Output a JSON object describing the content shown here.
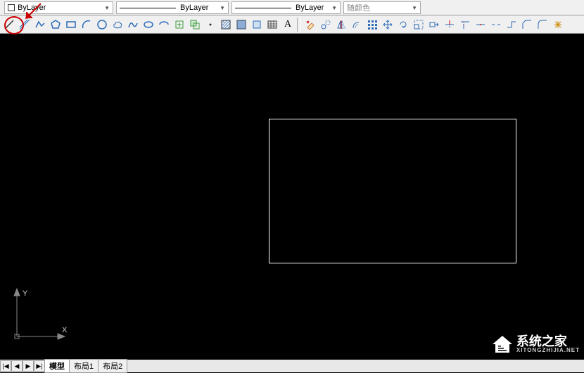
{
  "dropdowns": {
    "layer": {
      "label": "ByLayer"
    },
    "linetype": {
      "label": "ByLayer"
    },
    "lineweight": {
      "label": "ByLayer"
    },
    "color": {
      "label": "随颜色"
    }
  },
  "draw_tools": [
    {
      "name": "line-tool",
      "icon": "line"
    },
    {
      "name": "construction-line-tool",
      "icon": "xline"
    },
    {
      "name": "polyline-tool",
      "icon": "pline"
    },
    {
      "name": "polygon-tool",
      "icon": "polygon"
    },
    {
      "name": "rectangle-tool",
      "icon": "rect"
    },
    {
      "name": "arc-tool",
      "icon": "arc"
    },
    {
      "name": "circle-tool",
      "icon": "circle"
    },
    {
      "name": "revcloud-tool",
      "icon": "cloud"
    },
    {
      "name": "spline-tool",
      "icon": "spline"
    },
    {
      "name": "ellipse-tool",
      "icon": "ellipse"
    },
    {
      "name": "ellipse-arc-tool",
      "icon": "ellipsearc"
    },
    {
      "name": "insert-block-tool",
      "icon": "insert"
    },
    {
      "name": "make-block-tool",
      "icon": "block"
    },
    {
      "name": "point-tool",
      "icon": "point"
    },
    {
      "name": "hatch-tool",
      "icon": "hatch"
    },
    {
      "name": "gradient-tool",
      "icon": "gradient"
    },
    {
      "name": "region-tool",
      "icon": "region"
    },
    {
      "name": "table-tool",
      "icon": "table"
    },
    {
      "name": "text-tool",
      "icon": "text",
      "label": "A"
    }
  ],
  "modify_tools": [
    {
      "name": "erase-tool",
      "icon": "erase"
    },
    {
      "name": "copy-tool",
      "icon": "copy"
    },
    {
      "name": "mirror-tool",
      "icon": "mirror"
    },
    {
      "name": "offset-tool",
      "icon": "offset"
    },
    {
      "name": "array-tool",
      "icon": "array"
    },
    {
      "name": "move-tool",
      "icon": "move"
    },
    {
      "name": "rotate-tool",
      "icon": "rotate"
    },
    {
      "name": "scale-tool",
      "icon": "scale"
    },
    {
      "name": "stretch-tool",
      "icon": "stretch"
    },
    {
      "name": "trim-tool",
      "icon": "trim"
    },
    {
      "name": "extend-tool",
      "icon": "extend"
    },
    {
      "name": "break-at-point-tool",
      "icon": "breakpt"
    },
    {
      "name": "break-tool",
      "icon": "break"
    },
    {
      "name": "join-tool",
      "icon": "join"
    },
    {
      "name": "chamfer-tool",
      "icon": "chamfer"
    },
    {
      "name": "fillet-tool",
      "icon": "fillet"
    },
    {
      "name": "explode-tool",
      "icon": "explode"
    }
  ],
  "ucs": {
    "x_label": "X",
    "y_label": "Y"
  },
  "watermark": {
    "text": "系统之家",
    "sub": "XITONGZHIJIA.NET"
  },
  "tabs": {
    "nav": [
      "|◀",
      "◀",
      "▶",
      "▶|"
    ],
    "items": [
      {
        "label": "模型",
        "active": true
      },
      {
        "label": "布局1",
        "active": false
      },
      {
        "label": "布局2",
        "active": false
      }
    ]
  },
  "colors": {
    "highlight": "#cc0000",
    "icon_blue": "#2a6ab8",
    "icon_green": "#3a9a3a"
  }
}
